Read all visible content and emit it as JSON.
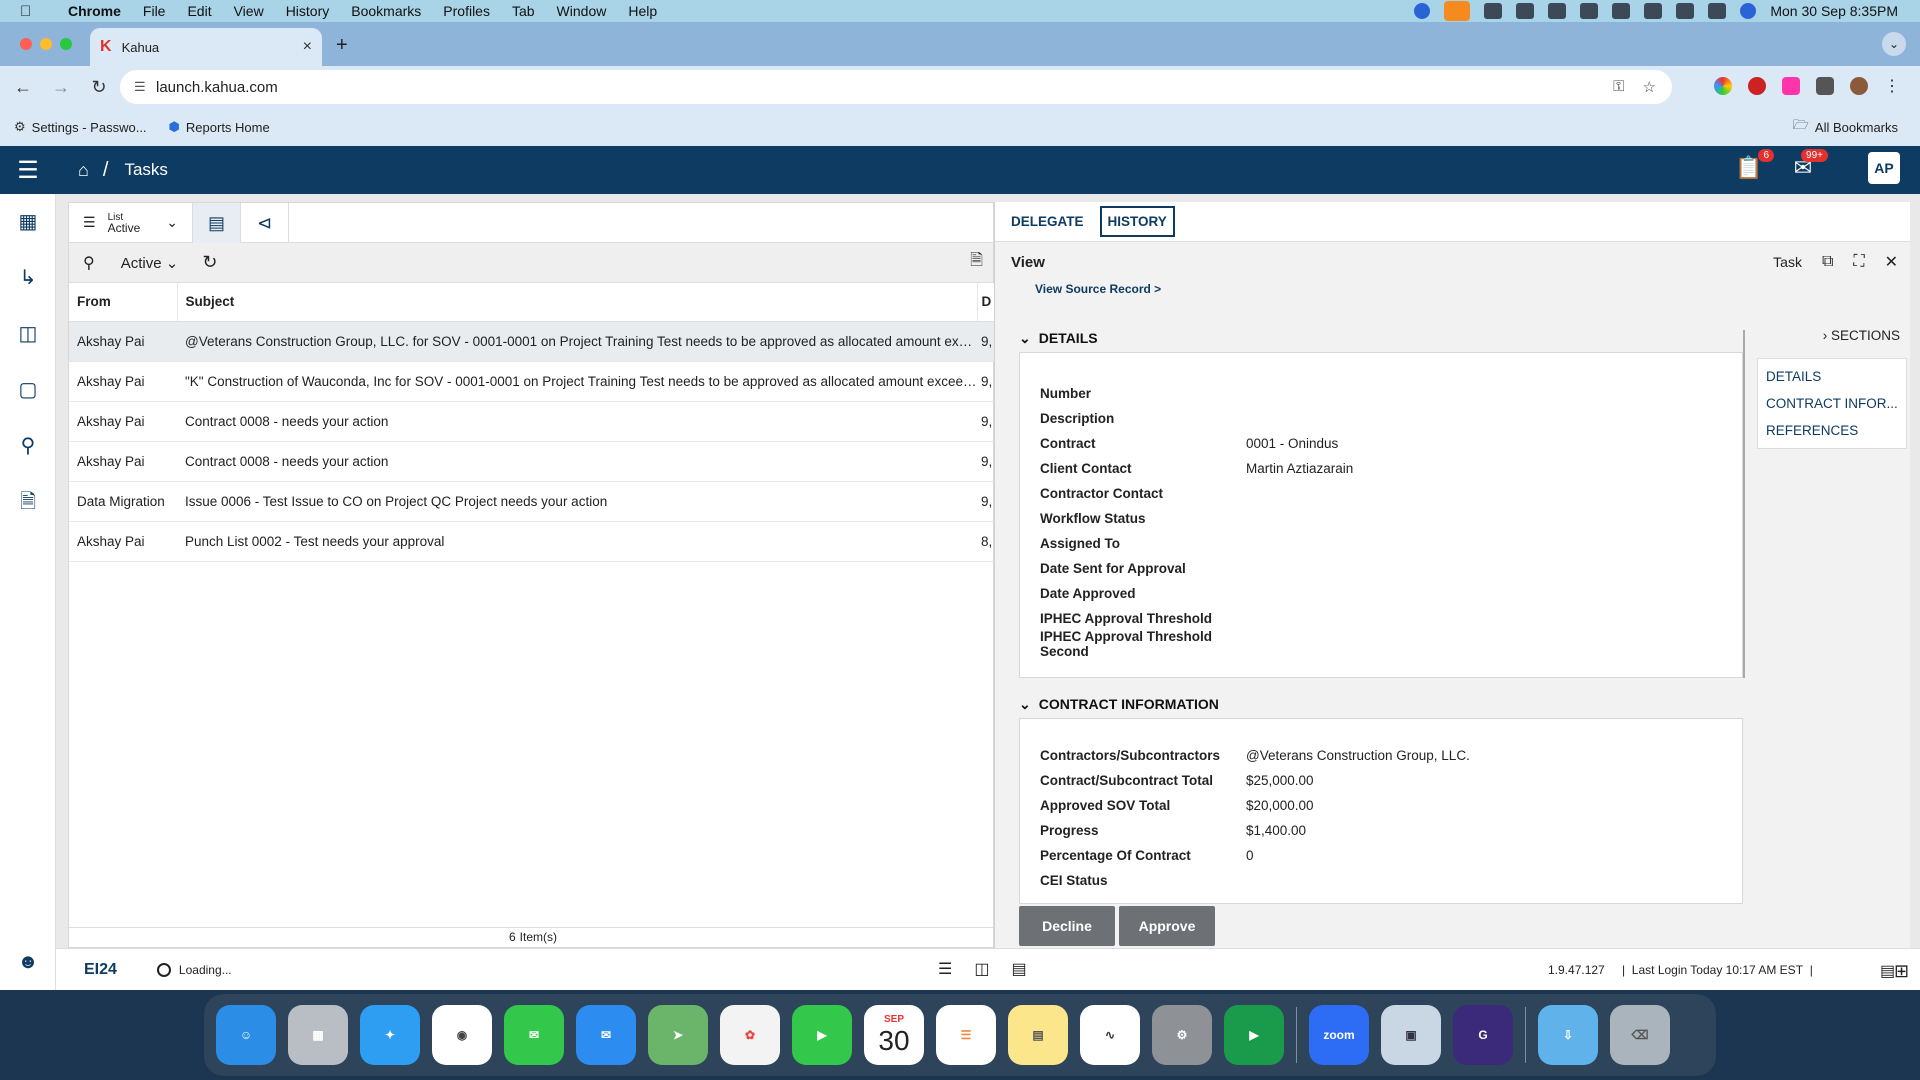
{
  "menubar": {
    "app": "Chrome",
    "items": [
      "File",
      "Edit",
      "View",
      "History",
      "Bookmarks",
      "Profiles",
      "Tab",
      "Window",
      "Help"
    ],
    "clock": "Mon 30 Sep  8:35PM"
  },
  "browser": {
    "tab_title": "Kahua",
    "url": "launch.kahua.com",
    "bookmarks": [
      "Settings - Passwo...",
      "Reports Home"
    ],
    "all_bookmarks": "All Bookmarks"
  },
  "app": {
    "breadcrumb": "Tasks",
    "tasks_badge": "6",
    "mail_badge": "99+",
    "avatar": "AP"
  },
  "list": {
    "view_label": "List",
    "view_value": "Active",
    "filter": "Active",
    "columns": [
      "From",
      "Subject",
      "D"
    ],
    "rows": [
      {
        "from": "Akshay Pai",
        "subject": "@Veterans Construction Group, LLC. for SOV - 0001-0001 on Project Training Test needs to be approved as allocated amount exceeds",
        "d": "9,"
      },
      {
        "from": "Akshay Pai",
        "subject": "\"K\" Construction of Wauconda, Inc for SOV - 0001-0001 on Project Training Test needs to be approved as allocated amount  exceeds",
        "d": "9,"
      },
      {
        "from": "Akshay Pai",
        "subject": "Contract 0008 -  needs your action",
        "d": "9,"
      },
      {
        "from": "Akshay Pai",
        "subject": "Contract 0008 -  needs your action",
        "d": "9,"
      },
      {
        "from": "Data Migration",
        "subject": "Issue 0006 - Test Issue to CO on Project QC Project needs your action",
        "d": "9,"
      },
      {
        "from": "Akshay Pai",
        "subject": "Punch List 0002 - Test needs your approval",
        "d": "8,"
      }
    ],
    "count": "6",
    "count_label": "Item(s)"
  },
  "detail": {
    "tabs": [
      "DELEGATE",
      "HISTORY"
    ],
    "view_title": "View",
    "task_label": "Task",
    "view_source": "View Source Record >",
    "sections_toggle": "SECTIONS",
    "section_links": [
      "DETAILS",
      "CONTRACT INFOR...",
      "REFERENCES"
    ],
    "details_title": "DETAILS",
    "details": [
      {
        "k": "Number",
        "v": ""
      },
      {
        "k": "Description",
        "v": ""
      },
      {
        "k": "Contract",
        "v": "0001 - Onindus"
      },
      {
        "k": "Client Contact",
        "v": "Martin Aztiazarain"
      },
      {
        "k": "Contractor Contact",
        "v": ""
      },
      {
        "k": "Workflow Status",
        "v": ""
      },
      {
        "k": "Assigned To",
        "v": ""
      },
      {
        "k": "Date Sent for Approval",
        "v": ""
      },
      {
        "k": "Date Approved",
        "v": ""
      },
      {
        "k": "IPHEC Approval Threshold",
        "v": ""
      },
      {
        "k": "IPHEC Approval Threshold Second",
        "v": ""
      }
    ],
    "contract_title": "CONTRACT INFORMATION",
    "contract": [
      {
        "k": "Contractors/Subcontractors",
        "v": "@Veterans Construction Group, LLC."
      },
      {
        "k": "Contract/Subcontract Total",
        "v": "$25,000.00"
      },
      {
        "k": "Approved SOV Total",
        "v": "$20,000.00"
      },
      {
        "k": "Progress",
        "v": "$1,400.00"
      },
      {
        "k": "Percentage Of Contract",
        "v": "0"
      },
      {
        "k": "CEI Status",
        "v": ""
      }
    ],
    "decline": "Decline",
    "approve": "Approve"
  },
  "status": {
    "brand": "EI24",
    "loading": "Loading...",
    "version": "1.9.47.127",
    "last_login": "Last Login Today 10:17 AM EST"
  },
  "dock": {
    "calendar_month": "SEP",
    "calendar_day": "30",
    "zoom": "zoom"
  }
}
